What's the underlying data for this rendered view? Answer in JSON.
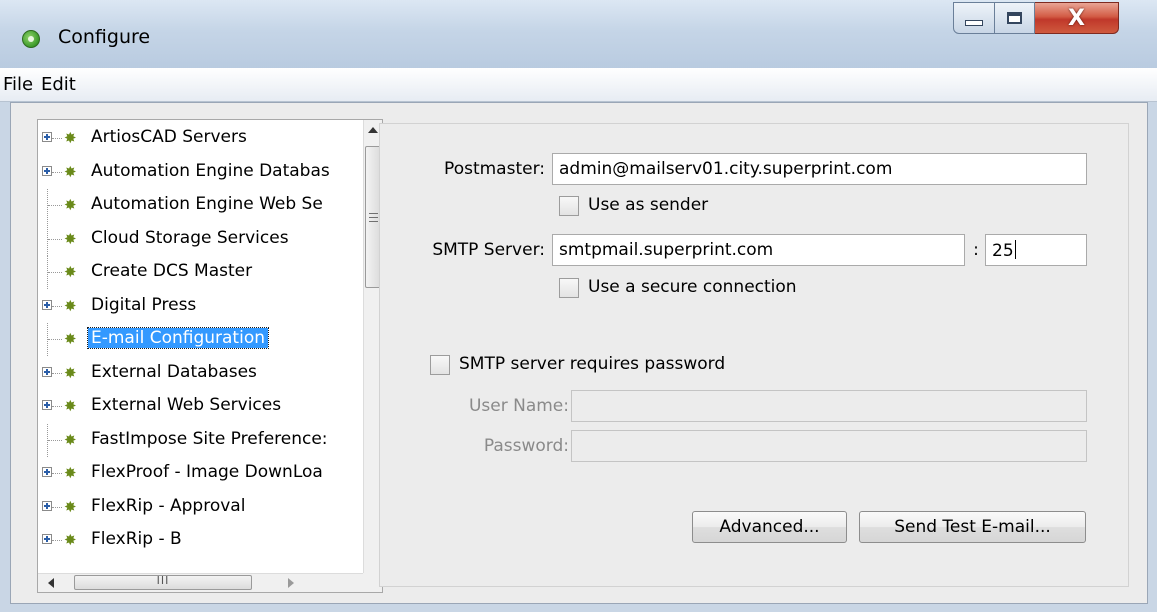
{
  "window": {
    "title": "Configure"
  },
  "menu": [
    "File",
    "Edit"
  ],
  "tree": {
    "items": [
      {
        "label": "ArtiosCAD Servers",
        "expandable": true
      },
      {
        "label": "Automation Engine Databas",
        "expandable": true
      },
      {
        "label": "Automation Engine Web Se",
        "expandable": false
      },
      {
        "label": "Cloud Storage Services",
        "expandable": false
      },
      {
        "label": "Create DCS Master",
        "expandable": false
      },
      {
        "label": "Digital Press",
        "expandable": true
      },
      {
        "label": "E-mail Configuration",
        "expandable": false,
        "selected": true
      },
      {
        "label": "External Databases",
        "expandable": true
      },
      {
        "label": "External Web Services",
        "expandable": true
      },
      {
        "label": "FastImpose Site Preference:",
        "expandable": false
      },
      {
        "label": "FlexProof - Image DownLoa",
        "expandable": true
      },
      {
        "label": "FlexRip - Approval",
        "expandable": true
      },
      {
        "label": "FlexRip - B",
        "expandable": true
      }
    ],
    "hscroll_grip": "III"
  },
  "form": {
    "postmaster_label": "Postmaster:",
    "postmaster_value": "admin@mailserv01.city.superprint.com",
    "use_as_sender_label": "Use as sender",
    "smtp_server_label": "SMTP Server:",
    "smtp_server_value": "smtpmail.superprint.com",
    "port_separator": ":",
    "port_value": "25",
    "secure_connection_label": "Use a secure connection",
    "requires_password_label": "SMTP server requires password",
    "user_name_label": "User Name:",
    "user_name_value": "",
    "password_label": "Password:",
    "password_value": ""
  },
  "buttons": {
    "advanced": "Advanced...",
    "send_test": "Send Test E-mail..."
  },
  "colors": {
    "selection": "#3399ff",
    "title_bar": "#c5d5e7",
    "close_button": "#c0382a"
  }
}
